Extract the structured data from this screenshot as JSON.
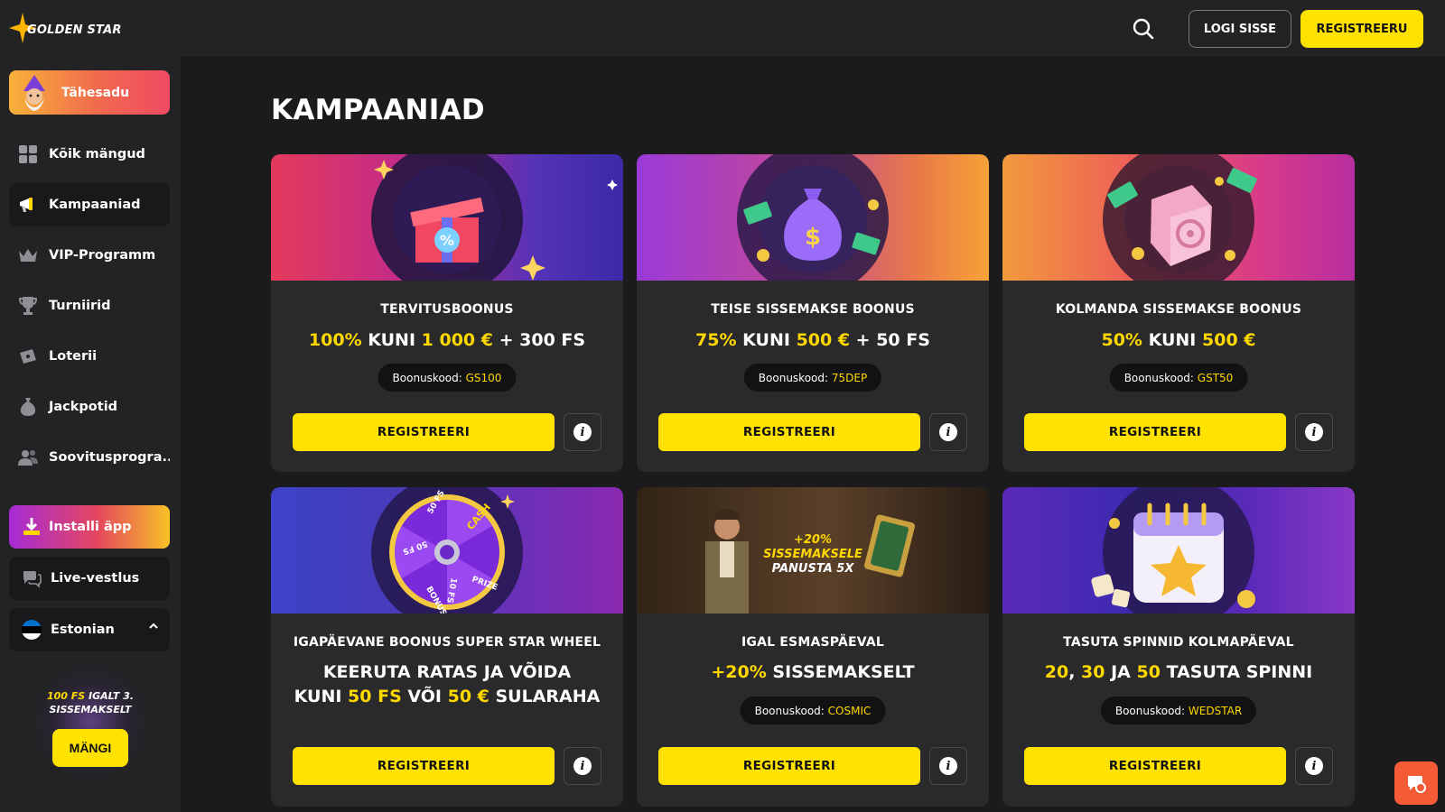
{
  "brand": {
    "name": "GOLDEN STAR"
  },
  "sidebar": {
    "promo_label": "Tähesadu",
    "items": [
      {
        "label": "Kõik mängud",
        "icon": "grid-icon"
      },
      {
        "label": "Kampaaniad",
        "icon": "megaphone-icon"
      },
      {
        "label": "VIP-Programm",
        "icon": "crown-icon"
      },
      {
        "label": "Turniirid",
        "icon": "trophy-icon"
      },
      {
        "label": "Loterii",
        "icon": "ticket-icon"
      },
      {
        "label": "Jackpotid",
        "icon": "money-bag-icon"
      },
      {
        "label": "Soovitusprogra...",
        "icon": "users-icon"
      }
    ],
    "install_label": "Installi äpp",
    "chat_label": "Live-vestlus",
    "language_label": "Estonian",
    "side_promo": {
      "fs": "100 FS",
      "line1_rest": " IGALT 3.",
      "line2": "SISSEMAKSELT",
      "button": "MÄNGI"
    }
  },
  "header": {
    "login_label": "LOGI SISSE",
    "register_label": "REGISTREERU"
  },
  "main": {
    "title": "KAMPAANIAD",
    "register_button": "REGISTREERI",
    "code_prefix": "Boonuskood:",
    "cards": [
      {
        "title": "TERVITUSBOONUS",
        "offer": [
          [
            "100%",
            "y"
          ],
          [
            " KUNI ",
            ""
          ],
          [
            "1 000 €",
            "y"
          ],
          [
            " + 300 FS",
            ""
          ]
        ],
        "code": "GS100"
      },
      {
        "title": "TEISE SISSEMAKSE BOONUS",
        "offer": [
          [
            "75%",
            "y"
          ],
          [
            " KUNI ",
            ""
          ],
          [
            "500 €",
            "y"
          ],
          [
            " + 50 FS",
            ""
          ]
        ],
        "code": "75DEP"
      },
      {
        "title": "KOLMANDA SISSEMAKSE BOONUS",
        "offer": [
          [
            "50%",
            "y"
          ],
          [
            " KUNI ",
            ""
          ],
          [
            "500 €",
            "y"
          ]
        ],
        "code": "GST50"
      },
      {
        "title": "IGAPÄEVANE BOONUS SUPER STAR WHEEL",
        "offer_lines": [
          [
            [
              "KEERUTA RATAS JA VÕIDA",
              ""
            ]
          ],
          [
            [
              "KUNI ",
              ""
            ],
            [
              "50 FS",
              "y"
            ],
            [
              " VÕI ",
              ""
            ],
            [
              "50 €",
              "y"
            ],
            [
              " SULARAHA",
              ""
            ]
          ]
        ]
      },
      {
        "title": "IGAL ESMASPÄEVAL",
        "offer": [
          [
            "+20%",
            "y"
          ],
          [
            " SISSEMAKSELT",
            ""
          ]
        ],
        "code": "COSMIC",
        "banner_text": [
          "+20%",
          "SISSEMAKSELE",
          "PANUSTA 5X"
        ]
      },
      {
        "title": "TASUTA SPINNID KOLMAPÄEVAL",
        "offer": [
          [
            "20",
            "y"
          ],
          [
            ", ",
            ""
          ],
          [
            "30",
            "y"
          ],
          [
            " JA ",
            ""
          ],
          [
            "50",
            "y"
          ],
          [
            " TASUTA SPINNI",
            ""
          ]
        ],
        "code": "WEDSTAR"
      }
    ]
  },
  "wheel_labels": [
    "CASH",
    "PRIZE",
    "BONUS",
    "10 FS",
    "50 FS",
    "50 FS"
  ],
  "colors": {
    "accent": "#ffe200",
    "highlight": "#ffd800",
    "bg": "#1b1b1d",
    "panel": "#232325",
    "card": "#2a2a2c"
  }
}
